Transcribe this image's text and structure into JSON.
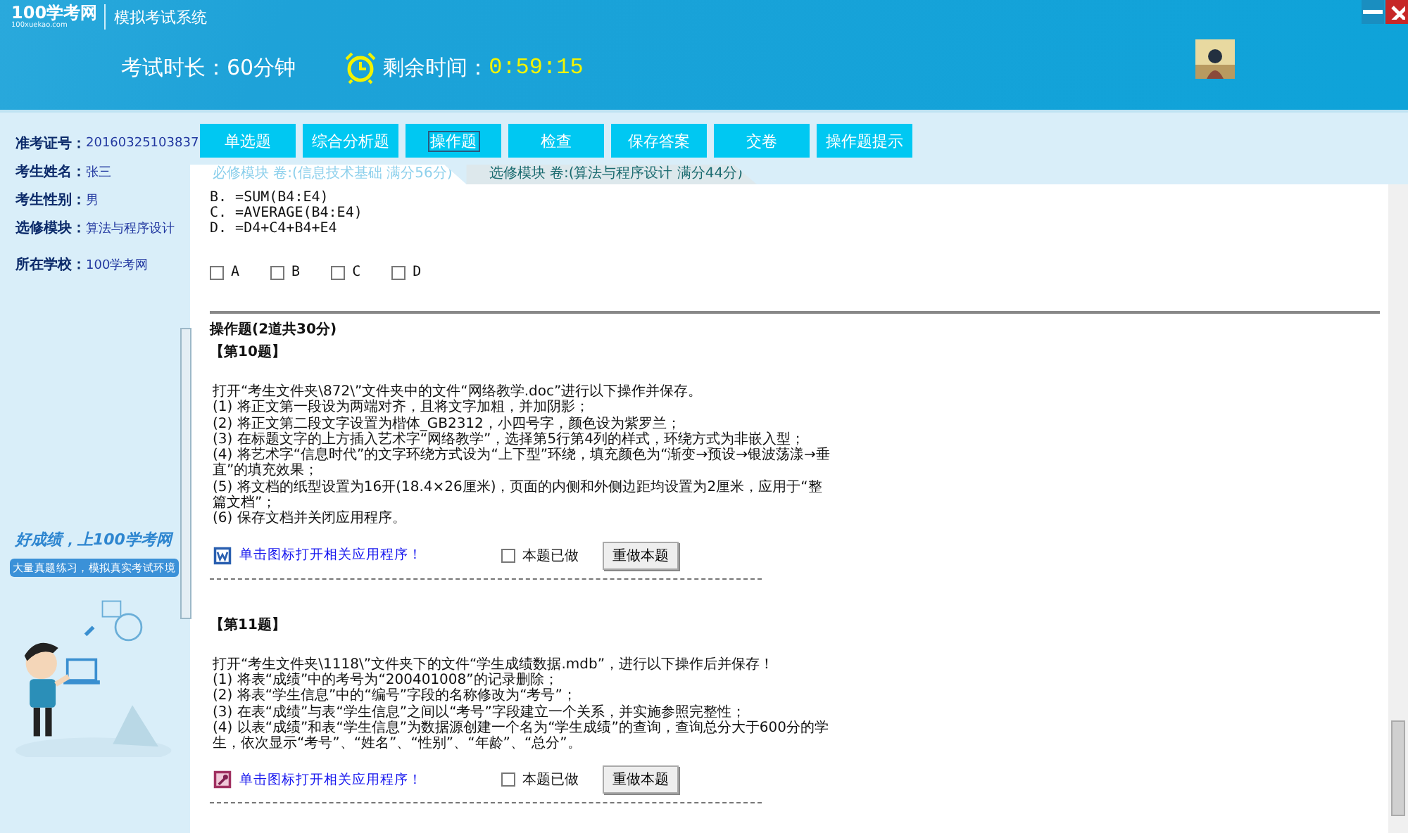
{
  "header": {
    "logo": "100学考网",
    "logo_sub": "100xuekao.com",
    "title": "模拟考试系统",
    "duration": "考试时长：60分钟",
    "remaining_label": "剩余时间：",
    "remaining_time": "0:59:15"
  },
  "candidate": [
    {
      "label": "准考证号：",
      "value": "20160325103837"
    },
    {
      "label": "考生姓名：",
      "value": "张三"
    },
    {
      "label": "考生性别：",
      "value": "男"
    },
    {
      "label": "选修模块：",
      "value": "算法与程序设计"
    },
    {
      "label": "所在学校：",
      "value": "100学考网"
    }
  ],
  "banner": {
    "slogan": "好成绩，上100学考网",
    "subtitle": "大量真题练习，模拟真实考试环境"
  },
  "toolbar": [
    {
      "label": "单选题",
      "selected": false
    },
    {
      "label": "综合分析题",
      "selected": false
    },
    {
      "label": "操作题",
      "selected": true
    },
    {
      "label": "检查",
      "selected": false
    },
    {
      "label": "保存答案",
      "selected": false
    },
    {
      "label": "交卷",
      "selected": false
    },
    {
      "label": "操作题提示",
      "selected": false
    }
  ],
  "tabs": [
    {
      "label": "必修模块 卷:(信息技术基础 满分56分)",
      "selected": true
    },
    {
      "label": "选修模块 卷:(算法与程序设计 满分44分)",
      "selected": false
    }
  ],
  "previous_options": [
    "B. =SUM(B4:E4)",
    "C. =AVERAGE(B4:E4)",
    "D. =D4+C4+B4+E4"
  ],
  "choices": [
    {
      "label": "A",
      "checked": false
    },
    {
      "label": "B",
      "checked": false
    },
    {
      "label": "C",
      "checked": false
    },
    {
      "label": "D",
      "checked": false
    }
  ],
  "section_title": "操作题(2道共30分)",
  "questions": [
    {
      "number": "【第10题】",
      "kind": "word",
      "link": "单击图标打开相关应用程序！",
      "done_label": "本题已做",
      "done": false,
      "redo": "重做本题",
      "lines": [
        "打开“考生文件夹\\872\\”文件夹中的文件“网络教学.doc”进行以下操作并保存。",
        "(1) 将正文第一段设为两端对齐，且将文字加粗，并加阴影；",
        "(2) 将正文第二段文字设置为楷体_GB2312，小四号字，颜色设为紫罗兰；",
        "(3) 在标题文字的上方插入艺术字“网络教学”，选择第5行第4列的样式，环绕方式为非嵌入型；",
        "(4) 将艺术字“信息时代”的文字环绕方式设为“上下型”环绕，填充颜色为“渐变→预设→银波荡漾→垂直”的填充效果；",
        "(5) 将文档的纸型设置为16开(18.4×26厘米)，页面的内侧和外侧边距均设置为2厘米，应用于“整篇文档”；",
        "(6) 保存文档并关闭应用程序。"
      ]
    },
    {
      "number": "【第11题】",
      "kind": "access",
      "link": "单击图标打开相关应用程序！",
      "done_label": "本题已做",
      "done": false,
      "redo": "重做本题",
      "lines": [
        "打开“考生文件夹\\1118\\”文件夹下的文件“学生成绩数据.mdb”，进行以下操作后并保存！",
        "(1) 将表“成绩”中的考号为“200401008”的记录删除；",
        "(2) 将表“学生信息”中的“编号”字段的名称修改为“考号”；",
        "(3) 在表“成绩”与表“学生信息”之间以“考号”字段建立一个关系，并实施参照完整性；",
        "(4) 以表“成绩”和表“学生信息”为数据源创建一个名为“学生成绩”的查询，查询总分大于600分的学生，依次显示“考号”、“姓名”、“性别”、“年龄”、“总分”。"
      ]
    }
  ]
}
